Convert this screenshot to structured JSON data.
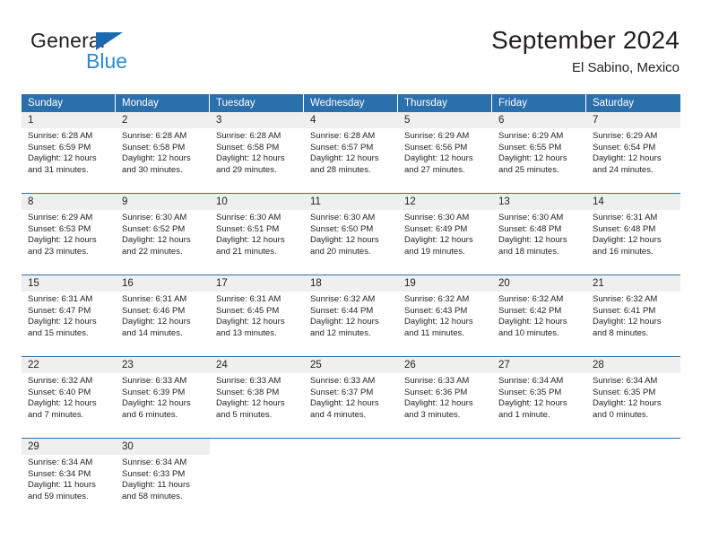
{
  "brand": {
    "name_top": "General",
    "name_bottom": "Blue",
    "triangle_color": "#1b6ab0",
    "blue_color": "#2b8ad6"
  },
  "header": {
    "title": "September 2024",
    "subtitle": "El Sabino, Mexico"
  },
  "theme": {
    "header_blue": "#2c6fad",
    "daynum_gray": "#efefef",
    "text": "#231f20"
  },
  "calendar": {
    "weekdays": [
      "Sunday",
      "Monday",
      "Tuesday",
      "Wednesday",
      "Thursday",
      "Friday",
      "Saturday"
    ],
    "weeks": [
      [
        {
          "day": "1",
          "sunrise": "Sunrise: 6:28 AM",
          "sunset": "Sunset: 6:59 PM",
          "daylight": "Daylight: 12 hours and 31 minutes."
        },
        {
          "day": "2",
          "sunrise": "Sunrise: 6:28 AM",
          "sunset": "Sunset: 6:58 PM",
          "daylight": "Daylight: 12 hours and 30 minutes."
        },
        {
          "day": "3",
          "sunrise": "Sunrise: 6:28 AM",
          "sunset": "Sunset: 6:58 PM",
          "daylight": "Daylight: 12 hours and 29 minutes."
        },
        {
          "day": "4",
          "sunrise": "Sunrise: 6:28 AM",
          "sunset": "Sunset: 6:57 PM",
          "daylight": "Daylight: 12 hours and 28 minutes."
        },
        {
          "day": "5",
          "sunrise": "Sunrise: 6:29 AM",
          "sunset": "Sunset: 6:56 PM",
          "daylight": "Daylight: 12 hours and 27 minutes."
        },
        {
          "day": "6",
          "sunrise": "Sunrise: 6:29 AM",
          "sunset": "Sunset: 6:55 PM",
          "daylight": "Daylight: 12 hours and 25 minutes."
        },
        {
          "day": "7",
          "sunrise": "Sunrise: 6:29 AM",
          "sunset": "Sunset: 6:54 PM",
          "daylight": "Daylight: 12 hours and 24 minutes."
        }
      ],
      [
        {
          "day": "8",
          "sunrise": "Sunrise: 6:29 AM",
          "sunset": "Sunset: 6:53 PM",
          "daylight": "Daylight: 12 hours and 23 minutes."
        },
        {
          "day": "9",
          "sunrise": "Sunrise: 6:30 AM",
          "sunset": "Sunset: 6:52 PM",
          "daylight": "Daylight: 12 hours and 22 minutes."
        },
        {
          "day": "10",
          "sunrise": "Sunrise: 6:30 AM",
          "sunset": "Sunset: 6:51 PM",
          "daylight": "Daylight: 12 hours and 21 minutes."
        },
        {
          "day": "11",
          "sunrise": "Sunrise: 6:30 AM",
          "sunset": "Sunset: 6:50 PM",
          "daylight": "Daylight: 12 hours and 20 minutes."
        },
        {
          "day": "12",
          "sunrise": "Sunrise: 6:30 AM",
          "sunset": "Sunset: 6:49 PM",
          "daylight": "Daylight: 12 hours and 19 minutes."
        },
        {
          "day": "13",
          "sunrise": "Sunrise: 6:30 AM",
          "sunset": "Sunset: 6:48 PM",
          "daylight": "Daylight: 12 hours and 18 minutes."
        },
        {
          "day": "14",
          "sunrise": "Sunrise: 6:31 AM",
          "sunset": "Sunset: 6:48 PM",
          "daylight": "Daylight: 12 hours and 16 minutes."
        }
      ],
      [
        {
          "day": "15",
          "sunrise": "Sunrise: 6:31 AM",
          "sunset": "Sunset: 6:47 PM",
          "daylight": "Daylight: 12 hours and 15 minutes."
        },
        {
          "day": "16",
          "sunrise": "Sunrise: 6:31 AM",
          "sunset": "Sunset: 6:46 PM",
          "daylight": "Daylight: 12 hours and 14 minutes."
        },
        {
          "day": "17",
          "sunrise": "Sunrise: 6:31 AM",
          "sunset": "Sunset: 6:45 PM",
          "daylight": "Daylight: 12 hours and 13 minutes."
        },
        {
          "day": "18",
          "sunrise": "Sunrise: 6:32 AM",
          "sunset": "Sunset: 6:44 PM",
          "daylight": "Daylight: 12 hours and 12 minutes."
        },
        {
          "day": "19",
          "sunrise": "Sunrise: 6:32 AM",
          "sunset": "Sunset: 6:43 PM",
          "daylight": "Daylight: 12 hours and 11 minutes."
        },
        {
          "day": "20",
          "sunrise": "Sunrise: 6:32 AM",
          "sunset": "Sunset: 6:42 PM",
          "daylight": "Daylight: 12 hours and 10 minutes."
        },
        {
          "day": "21",
          "sunrise": "Sunrise: 6:32 AM",
          "sunset": "Sunset: 6:41 PM",
          "daylight": "Daylight: 12 hours and 8 minutes."
        }
      ],
      [
        {
          "day": "22",
          "sunrise": "Sunrise: 6:32 AM",
          "sunset": "Sunset: 6:40 PM",
          "daylight": "Daylight: 12 hours and 7 minutes."
        },
        {
          "day": "23",
          "sunrise": "Sunrise: 6:33 AM",
          "sunset": "Sunset: 6:39 PM",
          "daylight": "Daylight: 12 hours and 6 minutes."
        },
        {
          "day": "24",
          "sunrise": "Sunrise: 6:33 AM",
          "sunset": "Sunset: 6:38 PM",
          "daylight": "Daylight: 12 hours and 5 minutes."
        },
        {
          "day": "25",
          "sunrise": "Sunrise: 6:33 AM",
          "sunset": "Sunset: 6:37 PM",
          "daylight": "Daylight: 12 hours and 4 minutes."
        },
        {
          "day": "26",
          "sunrise": "Sunrise: 6:33 AM",
          "sunset": "Sunset: 6:36 PM",
          "daylight": "Daylight: 12 hours and 3 minutes."
        },
        {
          "day": "27",
          "sunrise": "Sunrise: 6:34 AM",
          "sunset": "Sunset: 6:35 PM",
          "daylight": "Daylight: 12 hours and 1 minute."
        },
        {
          "day": "28",
          "sunrise": "Sunrise: 6:34 AM",
          "sunset": "Sunset: 6:35 PM",
          "daylight": "Daylight: 12 hours and 0 minutes."
        }
      ],
      [
        {
          "day": "29",
          "sunrise": "Sunrise: 6:34 AM",
          "sunset": "Sunset: 6:34 PM",
          "daylight": "Daylight: 11 hours and 59 minutes."
        },
        {
          "day": "30",
          "sunrise": "Sunrise: 6:34 AM",
          "sunset": "Sunset: 6:33 PM",
          "daylight": "Daylight: 11 hours and 58 minutes."
        },
        {
          "day": "",
          "sunrise": "",
          "sunset": "",
          "daylight": ""
        },
        {
          "day": "",
          "sunrise": "",
          "sunset": "",
          "daylight": ""
        },
        {
          "day": "",
          "sunrise": "",
          "sunset": "",
          "daylight": ""
        },
        {
          "day": "",
          "sunrise": "",
          "sunset": "",
          "daylight": ""
        },
        {
          "day": "",
          "sunrise": "",
          "sunset": "",
          "daylight": ""
        }
      ]
    ]
  }
}
